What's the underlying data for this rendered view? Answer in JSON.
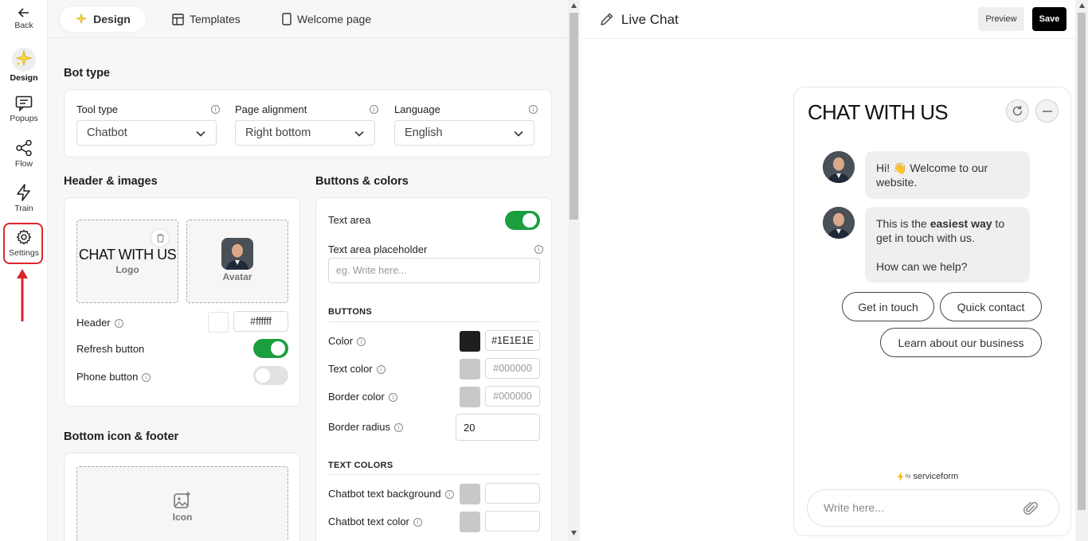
{
  "rail": {
    "back": "Back",
    "items": [
      {
        "label": "Design",
        "icon": "sparkle-icon"
      },
      {
        "label": "Popups",
        "icon": "message-icon"
      },
      {
        "label": "Flow",
        "icon": "share-icon"
      },
      {
        "label": "Train",
        "icon": "lightning-icon"
      },
      {
        "label": "Settings",
        "icon": "gear-icon"
      }
    ],
    "highlight_color": "#e0252f"
  },
  "tabs": [
    "Design",
    "Templates",
    "Welcome page"
  ],
  "bot_type": {
    "title": "Bot type",
    "tool_type_label": "Tool type",
    "tool_type_value": "Chatbot",
    "page_alignment_label": "Page alignment",
    "page_alignment_value": "Right bottom",
    "language_label": "Language",
    "language_value": "English"
  },
  "header_images": {
    "title": "Header & images",
    "logo_text": "CHAT WITH US",
    "logo_caption": "Logo",
    "avatar_caption": "Avatar",
    "header_label": "Header",
    "header_color": "#ffffff",
    "refresh_label": "Refresh button",
    "refresh_on": true,
    "phone_label": "Phone button",
    "phone_on": false
  },
  "bottom": {
    "title": "Bottom icon & footer",
    "icon_caption": "Icon"
  },
  "buttons_colors": {
    "title": "Buttons & colors",
    "text_area_label": "Text area",
    "text_area_on": true,
    "placeholder_label": "Text area placeholder",
    "placeholder_value": "eg. Write here...",
    "buttons_head": "BUTTONS",
    "color_label": "Color",
    "color_value": "#1E1E1E",
    "text_color_label": "Text color",
    "text_color_value": "#000000",
    "border_color_label": "Border color",
    "border_color_value": "#000000",
    "border_radius_label": "Border radius",
    "border_radius_value": "20",
    "text_colors_head": "TEXT COLORS",
    "chatbot_bg_label": "Chatbot text background",
    "chatbot_color_label": "Chatbot text color"
  },
  "preview": {
    "title": "Live Chat",
    "preview_btn": "Preview",
    "save_btn": "Save",
    "widget_title": "CHAT WITH US",
    "msg1": "Hi! 👋 Welcome to our website.",
    "msg2_pre": "This is the ",
    "msg2_bold": "easiest way",
    "msg2_post": " to get in touch with us.",
    "msg2_q": "How can we help?",
    "chips": [
      "Get in touch",
      "Quick contact",
      "Learn about our business"
    ],
    "powered_by": "by",
    "brand": "serviceform",
    "input_placeholder": "Write here..."
  }
}
